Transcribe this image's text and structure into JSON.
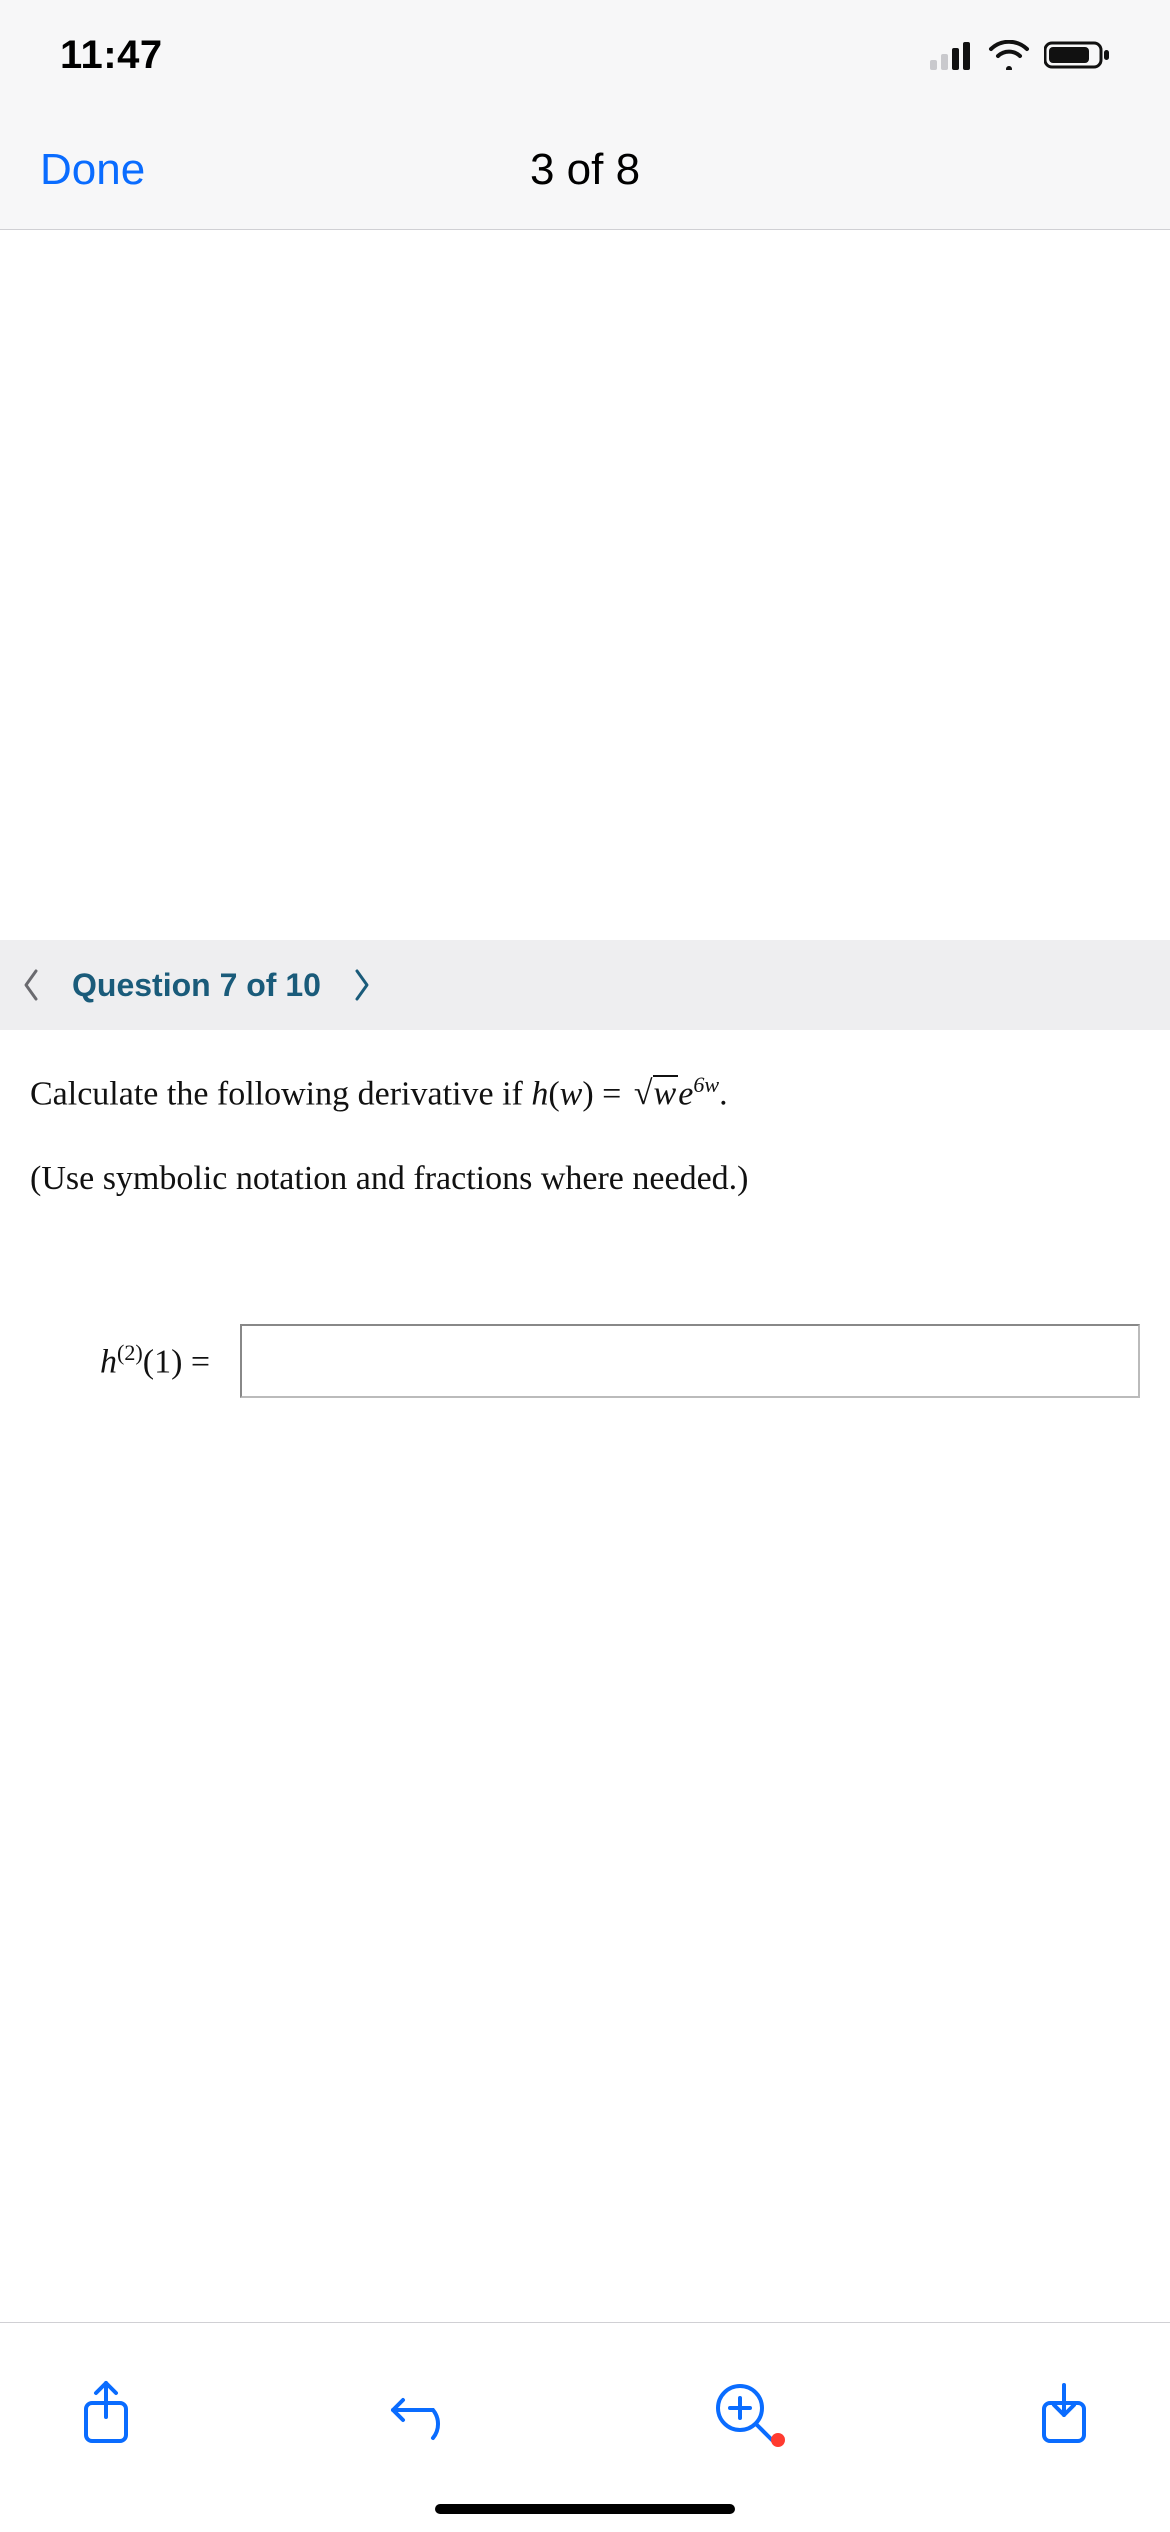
{
  "status": {
    "time": "11:47"
  },
  "nav": {
    "done_label": "Done",
    "title": "3 of 8"
  },
  "question_bar": {
    "label": "Question 7 of 10"
  },
  "problem": {
    "prefix": "Calculate the following derivative if ",
    "func_lhs_h": "h",
    "func_lhs_paren_open": "(",
    "func_lhs_w": "w",
    "func_lhs_paren_close": ") = ",
    "sqrt_inner_w": "w",
    "exp_e": "e",
    "exp_sup": "6w",
    "period": ".",
    "note": "(Use symbolic notation and fractions where needed.)"
  },
  "answer": {
    "label_h": "h",
    "label_sup": "(2)",
    "label_arg": "(1) = ",
    "value": ""
  }
}
